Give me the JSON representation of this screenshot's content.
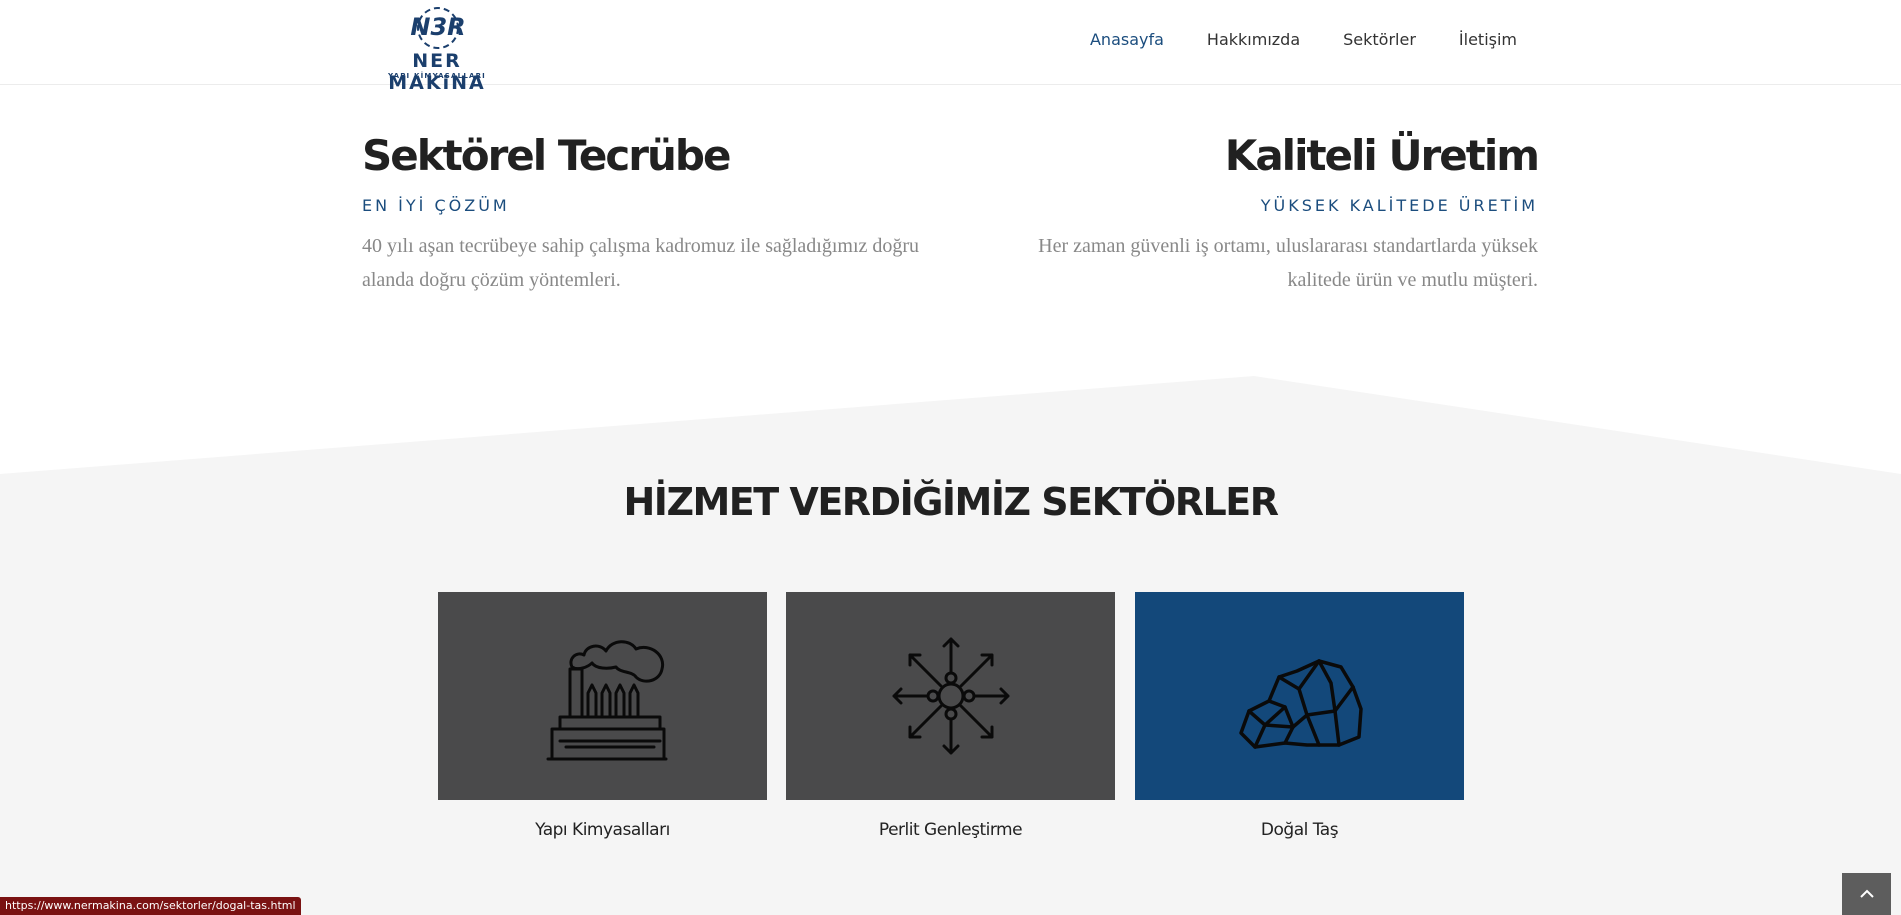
{
  "brand": {
    "name": "NER MAKiNA",
    "tagline": "YAPI KİMYASALLARI",
    "mark": "N3R",
    "color": "#1b3f6d"
  },
  "nav": {
    "items": [
      {
        "label": "Anasayfa",
        "active": true
      },
      {
        "label": "Hakkımızda",
        "active": false
      },
      {
        "label": "Sektörler",
        "active": false
      },
      {
        "label": "İletişim",
        "active": false
      }
    ]
  },
  "features": [
    {
      "title": "Sektörel Tecrübe",
      "subtitle": "EN İYİ ÇÖZÜM",
      "text": "40 yılı aşan tecrübeye sahip çalışma kadromuz ile sağladığımız doğru alanda doğru çözüm yöntemleri."
    },
    {
      "title": "Kaliteli Üretim",
      "subtitle": "YÜKSEK KALİTEDE ÜRETİM",
      "text": "Her zaman güvenli iş ortamı, uluslararası standartlarda yüksek kalitede ürün ve mutlu müşteri."
    }
  ],
  "sectors": {
    "title": "HİZMET VERDİĞİMİZ SEKTÖRLER",
    "items": [
      {
        "label": "Yapı Kimyasalları",
        "icon": "factory-icon"
      },
      {
        "label": "Perlit Genleştirme",
        "icon": "expansion-icon"
      },
      {
        "label": "Doğal Taş",
        "icon": "stone-icon"
      }
    ]
  },
  "status_bar": {
    "url": "https://www.nermakina.com/sektorler/dogal-tas.html"
  },
  "colors": {
    "accent": "#1b4d7e",
    "card": "#4a4a4b",
    "card_highlight": "#13487a"
  }
}
